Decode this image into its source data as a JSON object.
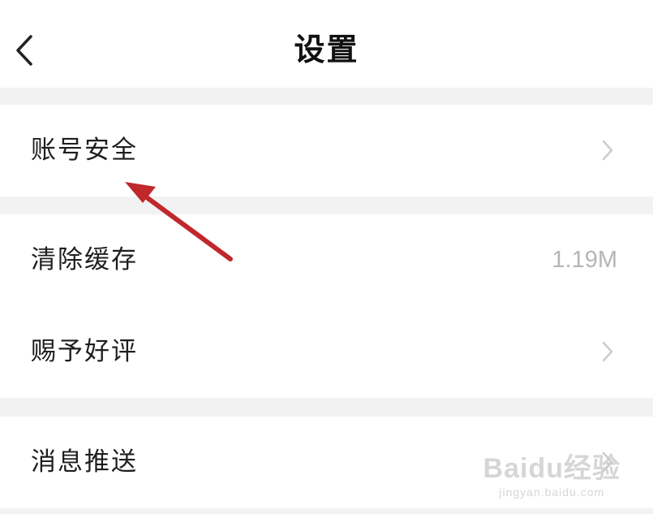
{
  "header": {
    "title": "设置",
    "back_icon": "chevron-left-icon"
  },
  "settings": {
    "account_security": {
      "label": "账号安全",
      "icon": "chevron-right-icon"
    },
    "clear_cache": {
      "label": "清除缓存",
      "value": "1.19M"
    },
    "rate_app": {
      "label": "赐予好评",
      "icon": "chevron-right-icon"
    },
    "push_notifications": {
      "label": "消息推送"
    }
  },
  "annotation": {
    "arrow_color": "#c0282b"
  },
  "watermark": {
    "main": "Baidu经验",
    "sub": "jingyan.baidu.com"
  },
  "colors": {
    "background": "#f2f2f2",
    "surface": "#ffffff",
    "text": "#1e1e1e",
    "secondary_text": "#b5b5b5"
  }
}
